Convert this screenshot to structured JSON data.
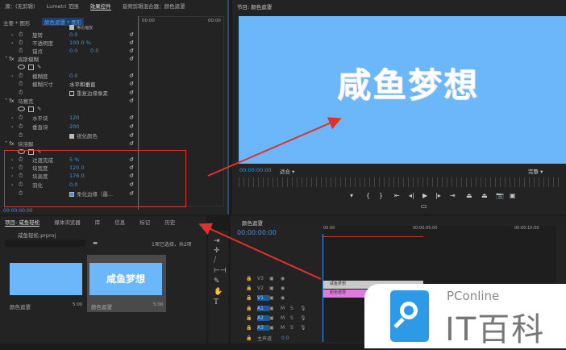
{
  "effect_controls": {
    "tabs": [
      "源：(无剪辑)",
      "Lumetri 范围",
      "效果控件",
      "音频剪辑混合器：颜色遮罩"
    ],
    "active_tab": 2,
    "source": "主要 * 图形",
    "clip": "颜色遮罩 * 图形",
    "mini_time_start": "00:00",
    "mini_time_end": "00:00",
    "uniform_scale": "等比缩放",
    "rows": [
      {
        "label": "旋转",
        "value": "0.0"
      },
      {
        "label": "不透明度",
        "value": "100.0 %"
      },
      {
        "label": "锚点",
        "value": "0.0",
        "value2": "0.0"
      }
    ],
    "gaussian": {
      "name": "高斯模糊",
      "blurriness_label": "模糊度",
      "blurriness": "0.0",
      "dim_label": "模糊尺寸",
      "dim_value": "水平和垂直",
      "repeat_label": "重复边缘像素"
    },
    "mosaic": {
      "name": "马赛克",
      "h_label": "水平块",
      "h_value": "120",
      "v_label": "垂直块",
      "v_value": "200",
      "sharpen_label": "锐化颜色"
    },
    "block_dissolve": {
      "name": "块溶解",
      "completion_label": "过渡完成",
      "completion": "5 %",
      "width_label": "块宽度",
      "width": "120.0",
      "height_label": "块高度",
      "height": "176.0",
      "feather_label": "羽化",
      "feather": "0.0",
      "soft_label": "柔化边缘（最..."
    },
    "timecode": "00:00:00:00"
  },
  "program": {
    "title": "节目: 颜色遮罩",
    "video_text": "咸鱼梦想",
    "timecode": "00:00:00:00",
    "fit": "适合",
    "quality": "完整"
  },
  "project": {
    "tabs": [
      "项目: 咸鱼轻松",
      "媒体浏览器",
      "库",
      "信息",
      "标记",
      "历史"
    ],
    "file": "咸鱼轻松.prproj",
    "selection": "1项已选择，共2项",
    "items": [
      {
        "name": "颜色遮罩",
        "duration": "5:00",
        "text": ""
      },
      {
        "name": "颜色遮罩",
        "duration": "5:00",
        "text": "咸鱼梦想"
      }
    ]
  },
  "timeline": {
    "title": "颜色遮罩",
    "timecode": "00:00:00:00",
    "ruler": [
      "00:00",
      "00:00:05:00",
      "00:00:10:00"
    ],
    "video_tracks": [
      "V3",
      "V2",
      "V1"
    ],
    "audio_tracks": [
      "A1",
      "A2",
      "A3"
    ],
    "master": "主声道",
    "master_value": "0.0",
    "clips": [
      {
        "name": "咸鱼梦想",
        "color": "#c9c9c9"
      },
      {
        "name": "颜色遮罩",
        "color": "#e07ae0"
      }
    ]
  },
  "watermark": {
    "brand": "PConline",
    "name": "IT百科"
  }
}
